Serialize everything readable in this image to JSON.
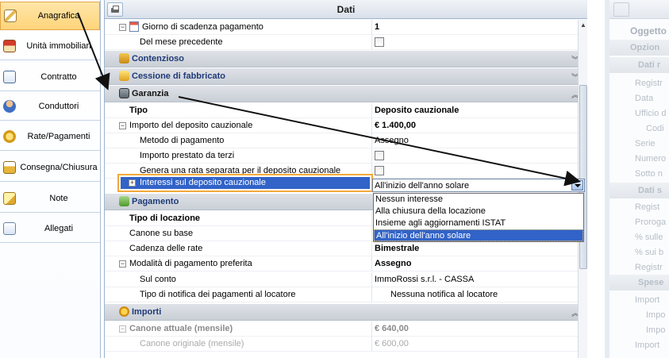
{
  "nav": {
    "items": [
      {
        "label": "Anagrafica",
        "active": true
      },
      {
        "label": "Unità immobiliari"
      },
      {
        "label": "Contratto"
      },
      {
        "label": "Conduttori"
      },
      {
        "label": "Rate/Pagamenti"
      },
      {
        "label": "Consegna/Chiusura"
      },
      {
        "label": "Note"
      },
      {
        "label": "Allegati"
      }
    ]
  },
  "main": {
    "title": "Dati",
    "rows": {
      "giorno_label": "Giorno di scadenza pagamento",
      "giorno_value": "1",
      "mese_label": "Del mese precedente",
      "contenzioso": "Contenzioso",
      "cessione": "Cessione di fabbricato",
      "garanzia": "Garanzia",
      "tipo_label": "Tipo",
      "tipo_value": "Deposito cauzionale",
      "importo_label": "Importo del deposito cauzionale",
      "importo_value": "€ 1.400,00",
      "metodo_label": "Metodo di pagamento",
      "metodo_value": "Assegno",
      "prestato_label": "Importo prestato da terzi",
      "genera_label": "Genera una rata separata per il deposito cauzionale",
      "interessi_label": "Interessi sul deposito cauzionale",
      "interessi_value": "All'inizio dell'anno solare",
      "pagamento": "Pagamento",
      "tipo_locazione_label": "Tipo di locazione",
      "canone_base_label": "Canone su base",
      "cadenza_label": "Cadenza delle rate",
      "cadenza_value": "Bimestrale",
      "modalita_label": "Modalità di pagamento preferita",
      "modalita_value": "Assegno",
      "conto_label": "Sul conto",
      "conto_value": "ImmoRossi s.r.l. - CASSA",
      "notifica_label": "Tipo di notifica dei pagamenti al locatore",
      "notifica_value": "Nessuna notifica al locatore",
      "importi": "Importi",
      "canone_attuale_label": "Canone attuale (mensile)",
      "canone_attuale_value": "€ 640,00",
      "canone_originale_label": "Canone originale (mensile)",
      "canone_originale_value": "€ 600,00"
    },
    "dropdown_options": [
      "Nessun interesse",
      "Alla chiusura della locazione",
      "Insieme agli aggiornamenti ISTAT",
      "All'inizio dell'anno solare"
    ]
  },
  "right_panel": {
    "title": "Oggetto",
    "items": [
      "Opzion",
      "Dati r",
      "Registr",
      "Data",
      "Ufficio d",
      "Codi",
      "Serie",
      "Numero",
      "Sotto n",
      "Dati s",
      "Regist",
      "Proroga",
      "% sulle",
      "% sui b",
      "Registr",
      "Spese",
      "Import",
      "Impo",
      "Impo",
      "Import"
    ]
  }
}
